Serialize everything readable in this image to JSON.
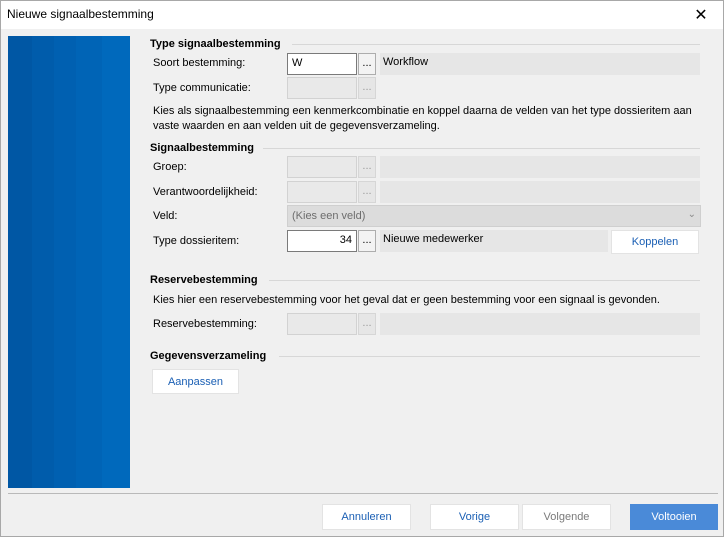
{
  "window": {
    "title": "Nieuwe signaalbestemming",
    "close_glyph": "✕"
  },
  "type_section": {
    "title": "Type signaalbestemming",
    "soort_label": "Soort bestemming:",
    "soort_value": "W",
    "soort_button": "...",
    "soort_display": "Workflow",
    "typecomm_label": "Type communicatie:",
    "typecomm_value": "",
    "typecomm_button": "...",
    "description": "Kies als signaalbestemming een kenmerkcombinatie en koppel daarna de velden van het type dossieritem aan vaste waarden en aan velden uit de gegevensverzameling."
  },
  "signaal_section": {
    "title": "Signaalbestemming",
    "groep_label": "Groep:",
    "groep_button": "...",
    "verantw_label": "Verantwoordelijkheid:",
    "verantw_button": "...",
    "veld_label": "Veld:",
    "veld_placeholder": "(Kies een veld)",
    "dossier_label": "Type dossieritem:",
    "dossier_value": "34",
    "dossier_button": "...",
    "dossier_display": "Nieuwe medewerker",
    "koppelen_button": "Koppelen"
  },
  "reserve_section": {
    "title": "Reservebestemming",
    "description": "Kies hier een reservebestemming voor het geval dat er geen bestemming voor een signaal is gevonden.",
    "label": "Reservebestemming:",
    "button": "..."
  },
  "gegevens_section": {
    "title": "Gegevensverzameling",
    "aanpassen_button": "Aanpassen"
  },
  "footer": {
    "annuleren": "Annuleren",
    "vorige": "Vorige",
    "volgende": "Volgende",
    "voltooien": "Voltooien"
  },
  "colors": {
    "side_panel": "#0060b0",
    "primary_button": "#4a8ad8",
    "link_text": "#1a5fb4"
  }
}
